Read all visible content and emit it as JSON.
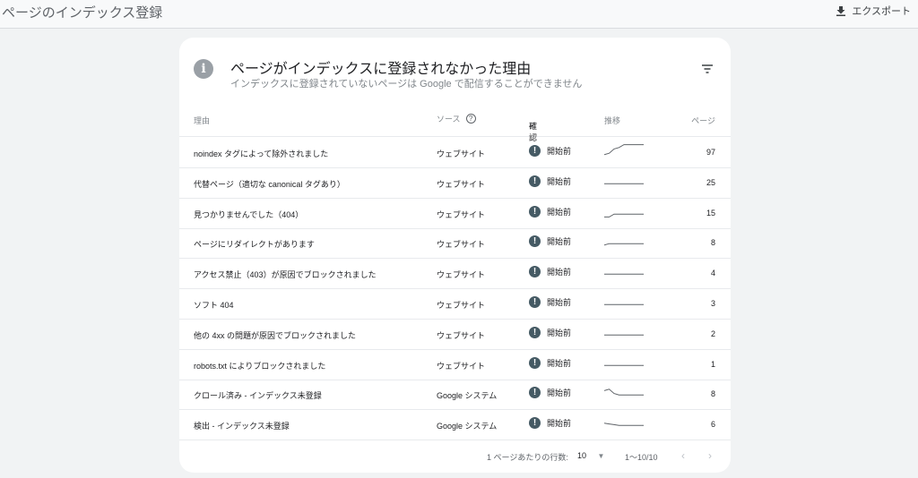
{
  "header": {
    "title": "ページのインデックス登録",
    "export_label": "エクスポート"
  },
  "card": {
    "title": "ページがインデックスに登録されなかった理由",
    "subtitle": "インデックスに登録されていないページは Google で配信することができません"
  },
  "columns": {
    "reason": "理由",
    "source": "ソース",
    "status": "確認",
    "trend": "推移",
    "pages": "ページ"
  },
  "rows": [
    {
      "reason": "noindex タグによって除外されました",
      "source": "ウェブサイト",
      "status": "開始前",
      "pages": "97",
      "trend": [
        0.2,
        0.3,
        0.6,
        0.7,
        0.9,
        0.9,
        0.9,
        0.9,
        0.9
      ]
    },
    {
      "reason": "代替ページ（適切な canonical タグあり）",
      "source": "ウェブサイト",
      "status": "開始前",
      "pages": "25",
      "trend": [
        0.3,
        0.3,
        0.3,
        0.3,
        0.3,
        0.3,
        0.3,
        0.3,
        0.3
      ]
    },
    {
      "reason": "見つかりませんでした（404）",
      "source": "ウェブサイト",
      "status": "開始前",
      "pages": "15",
      "trend": [
        0.1,
        0.1,
        0.3,
        0.3,
        0.3,
        0.3,
        0.3,
        0.3,
        0.3
      ]
    },
    {
      "reason": "ページにリダイレクトがあります",
      "source": "ウェブサイト",
      "status": "開始前",
      "pages": "8",
      "trend": [
        0.2,
        0.3,
        0.3,
        0.3,
        0.3,
        0.3,
        0.3,
        0.3,
        0.3
      ]
    },
    {
      "reason": "アクセス禁止（403）が原因でブロックされました",
      "source": "ウェブサイト",
      "status": "開始前",
      "pages": "4",
      "trend": [
        0.3,
        0.3,
        0.3,
        0.3,
        0.3,
        0.3,
        0.3,
        0.3,
        0.3
      ]
    },
    {
      "reason": "ソフト 404",
      "source": "ウェブサイト",
      "status": "開始前",
      "pages": "3",
      "trend": [
        0.3,
        0.3,
        0.3,
        0.3,
        0.3,
        0.3,
        0.3,
        0.3,
        0.3
      ]
    },
    {
      "reason": "他の 4xx の問題が原因でブロックされました",
      "source": "ウェブサイト",
      "status": "開始前",
      "pages": "2",
      "trend": [
        0.3,
        0.3,
        0.3,
        0.3,
        0.3,
        0.3,
        0.3,
        0.3,
        0.3
      ]
    },
    {
      "reason": "robots.txt によりブロックされました",
      "source": "ウェブサイト",
      "status": "開始前",
      "pages": "1",
      "trend": [
        0.3,
        0.3,
        0.3,
        0.3,
        0.3,
        0.3,
        0.3,
        0.3,
        0.3
      ]
    },
    {
      "reason": "クロール済み - インデックス未登録",
      "source": "Google システム",
      "status": "開始前",
      "pages": "8",
      "trend": [
        0.6,
        0.7,
        0.4,
        0.3,
        0.3,
        0.3,
        0.3,
        0.3,
        0.3
      ]
    },
    {
      "reason": "検出 - インデックス未登録",
      "source": "Google システム",
      "status": "開始前",
      "pages": "6",
      "trend": [
        0.45,
        0.4,
        0.35,
        0.3,
        0.3,
        0.3,
        0.3,
        0.3,
        0.3
      ]
    }
  ],
  "footer": {
    "rows_per_page_label": "1 ページあたりの行数:",
    "rows_per_page": "10",
    "range": "1〜10/10"
  },
  "icons": {
    "info": "info-icon",
    "filter": "filter-icon",
    "help": "help-icon",
    "sort": "arrow-down-icon",
    "status": "exclamation-icon",
    "download": "download-icon"
  }
}
